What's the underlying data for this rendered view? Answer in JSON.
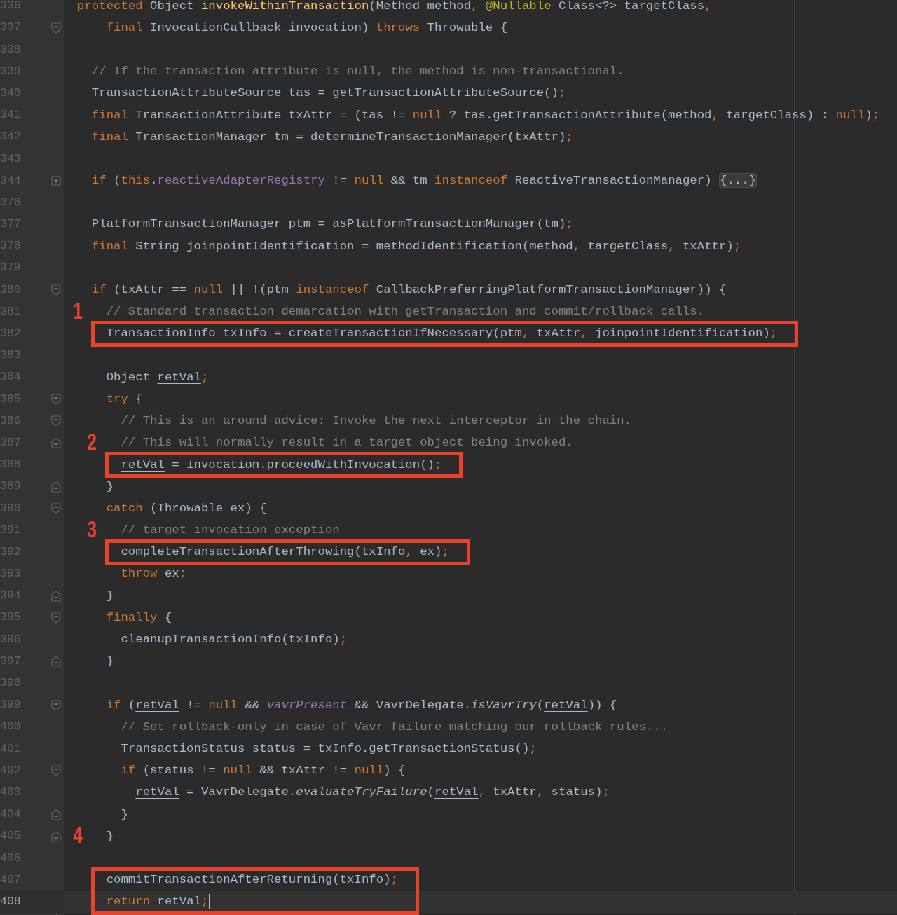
{
  "editor": {
    "lines": [
      {
        "number": "336",
        "current": false,
        "tokens": [
          {
            "kind": "keyword",
            "text": "protected"
          },
          {
            "kind": "plain",
            "text": " Object "
          },
          {
            "kind": "declaration",
            "text": "invokeWithinTransaction"
          },
          {
            "kind": "plain",
            "text": "(Method method"
          },
          {
            "kind": "keyword",
            "text": ","
          },
          {
            "kind": "annotation",
            "text": " @Nullable"
          },
          {
            "kind": "plain",
            "text": " Class<?> targetClass"
          },
          {
            "kind": "keyword",
            "text": ","
          }
        ]
      },
      {
        "number": "337",
        "current": false,
        "fold_start": true,
        "tokens": [
          {
            "kind": "keyword",
            "text": "    final"
          },
          {
            "kind": "plain",
            "text": " InvocationCallback invocation) "
          },
          {
            "kind": "keyword",
            "text": "throws"
          },
          {
            "kind": "plain",
            "text": " Throwable {"
          }
        ]
      },
      {
        "number": "338",
        "current": false
      },
      {
        "number": "339",
        "current": false,
        "tokens": [
          {
            "kind": "comment",
            "text": "  // If the transaction attribute is null, the method is non-transactional."
          }
        ]
      },
      {
        "number": "340",
        "current": false,
        "tokens": [
          {
            "kind": "plain",
            "text": "  TransactionAttributeSource tas = getTransactionAttributeSource()"
          },
          {
            "kind": "keyword",
            "text": ";"
          }
        ]
      },
      {
        "number": "341",
        "current": false,
        "tokens": [
          {
            "kind": "keyword",
            "text": "  final"
          },
          {
            "kind": "plain",
            "text": " TransactionAttribute txAttr = (tas != "
          },
          {
            "kind": "keyword",
            "text": "null"
          },
          {
            "kind": "plain",
            "text": " ? tas.getTransactionAttribute(method"
          },
          {
            "kind": "keyword",
            "text": ","
          },
          {
            "kind": "plain",
            "text": " targetClass) : "
          },
          {
            "kind": "keyword",
            "text": "null"
          },
          {
            "kind": "plain",
            "text": ")"
          },
          {
            "kind": "keyword",
            "text": ";"
          }
        ]
      },
      {
        "number": "342",
        "current": false,
        "tokens": [
          {
            "kind": "keyword",
            "text": "  final"
          },
          {
            "kind": "plain",
            "text": " TransactionManager tm = determineTransactionManager(txAttr)"
          },
          {
            "kind": "keyword",
            "text": ";"
          }
        ]
      },
      {
        "number": "343",
        "current": false
      },
      {
        "number": "344",
        "current": false,
        "collapsed": true,
        "tokens": [
          {
            "kind": "keyword",
            "text": "  if"
          },
          {
            "kind": "plain",
            "text": " ("
          },
          {
            "kind": "keyword",
            "text": "this"
          },
          {
            "kind": "plain",
            "text": "."
          },
          {
            "kind": "field",
            "text": "reactiveAdapterRegistry"
          },
          {
            "kind": "plain",
            "text": " != "
          },
          {
            "kind": "keyword",
            "text": "null"
          },
          {
            "kind": "plain",
            "text": " && tm "
          },
          {
            "kind": "keyword",
            "text": "instanceof"
          },
          {
            "kind": "plain",
            "text": " ReactiveTransactionManager) "
          },
          {
            "kind": "folded",
            "text": "{...}"
          }
        ]
      },
      {
        "number": "376",
        "current": false
      },
      {
        "number": "377",
        "current": false,
        "tokens": [
          {
            "kind": "plain",
            "text": "  PlatformTransactionManager ptm = asPlatformTransactionManager(tm)"
          },
          {
            "kind": "keyword",
            "text": ";"
          }
        ]
      },
      {
        "number": "378",
        "current": false,
        "tokens": [
          {
            "kind": "keyword",
            "text": "  final"
          },
          {
            "kind": "plain",
            "text": " String joinpointIdentification = methodIdentification(method"
          },
          {
            "kind": "keyword",
            "text": ","
          },
          {
            "kind": "plain",
            "text": " targetClass"
          },
          {
            "kind": "keyword",
            "text": ","
          },
          {
            "kind": "plain",
            "text": " txAttr)"
          },
          {
            "kind": "keyword",
            "text": ";"
          }
        ]
      },
      {
        "number": "379",
        "current": false
      },
      {
        "number": "380",
        "current": false,
        "fold_start": true,
        "tokens": [
          {
            "kind": "keyword",
            "text": "  if"
          },
          {
            "kind": "plain",
            "text": " (txAttr == "
          },
          {
            "kind": "keyword",
            "text": "null"
          },
          {
            "kind": "plain",
            "text": " || !(ptm "
          },
          {
            "kind": "keyword",
            "text": "instanceof"
          },
          {
            "kind": "plain",
            "text": " CallbackPreferringPlatformTransactionManager)) {"
          }
        ]
      },
      {
        "number": "381",
        "current": false,
        "marker": "1",
        "tokens": [
          {
            "kind": "comment",
            "text": "    // Standard transaction demarcation with getTransaction and commit/rollback calls."
          }
        ]
      },
      {
        "number": "382",
        "current": false,
        "boxed": true,
        "tokens": [
          {
            "kind": "plain",
            "text": "    TransactionInfo txInfo = createTransactionIfNecessary(ptm"
          },
          {
            "kind": "keyword",
            "text": ","
          },
          {
            "kind": "plain",
            "text": " txAttr"
          },
          {
            "kind": "keyword",
            "text": ","
          },
          {
            "kind": "plain",
            "text": " joinpointIdentification)"
          },
          {
            "kind": "keyword",
            "text": ";"
          }
        ]
      },
      {
        "number": "383",
        "current": false
      },
      {
        "number": "384",
        "current": false,
        "tokens": [
          {
            "kind": "plain",
            "text": "    Object "
          },
          {
            "kind": "variable",
            "text": "retVal"
          },
          {
            "kind": "keyword",
            "text": ";"
          }
        ]
      },
      {
        "number": "385",
        "current": false,
        "fold_start": true,
        "tokens": [
          {
            "kind": "keyword",
            "text": "    try"
          },
          {
            "kind": "plain",
            "text": " {"
          }
        ]
      },
      {
        "number": "386",
        "current": false,
        "fold_start": true,
        "tokens": [
          {
            "kind": "comment",
            "text": "      // This is an around advice: Invoke the next interceptor in the chain."
          }
        ]
      },
      {
        "number": "387",
        "current": false,
        "fold_end": true,
        "marker": "2",
        "tokens": [
          {
            "kind": "comment",
            "text": "      // This will normally result in a target object being invoked."
          }
        ]
      },
      {
        "number": "388",
        "current": false,
        "boxed": true,
        "tokens": [
          {
            "kind": "variable",
            "text": "      retVal"
          },
          {
            "kind": "plain",
            "text": " = invocation.proceedWithInvocation()"
          },
          {
            "kind": "keyword",
            "text": ";"
          }
        ]
      },
      {
        "number": "389",
        "current": false,
        "fold_end": true,
        "tokens": [
          {
            "kind": "plain",
            "text": "    }"
          }
        ]
      },
      {
        "number": "390",
        "current": false,
        "fold_start": true,
        "tokens": [
          {
            "kind": "keyword",
            "text": "    catch"
          },
          {
            "kind": "plain",
            "text": " (Throwable ex) {"
          }
        ]
      },
      {
        "number": "391",
        "current": false,
        "marker": "3",
        "tokens": [
          {
            "kind": "comment",
            "text": "      // target invocation exception"
          }
        ]
      },
      {
        "number": "392",
        "current": false,
        "boxed": true,
        "tokens": [
          {
            "kind": "plain",
            "text": "      completeTransactionAfterThrowing(txInfo"
          },
          {
            "kind": "keyword",
            "text": ","
          },
          {
            "kind": "plain",
            "text": " ex)"
          },
          {
            "kind": "keyword",
            "text": ";"
          }
        ]
      },
      {
        "number": "393",
        "current": false,
        "tokens": [
          {
            "kind": "keyword",
            "text": "      throw"
          },
          {
            "kind": "plain",
            "text": " ex"
          },
          {
            "kind": "keyword",
            "text": ";"
          }
        ]
      },
      {
        "number": "394",
        "current": false,
        "fold_end": true,
        "tokens": [
          {
            "kind": "plain",
            "text": "    }"
          }
        ]
      },
      {
        "number": "395",
        "current": false,
        "fold_start": true,
        "tokens": [
          {
            "kind": "keyword",
            "text": "    finally"
          },
          {
            "kind": "plain",
            "text": " {"
          }
        ]
      },
      {
        "number": "396",
        "current": false,
        "tokens": [
          {
            "kind": "plain",
            "text": "      cleanupTransactionInfo(txInfo)"
          },
          {
            "kind": "keyword",
            "text": ";"
          }
        ]
      },
      {
        "number": "397",
        "current": false,
        "fold_end": true,
        "tokens": [
          {
            "kind": "plain",
            "text": "    }"
          }
        ]
      },
      {
        "number": "398",
        "current": false
      },
      {
        "number": "399",
        "current": false,
        "fold_start": true,
        "tokens": [
          {
            "kind": "keyword",
            "text": "    if"
          },
          {
            "kind": "plain",
            "text": " ("
          },
          {
            "kind": "variable",
            "text": "retVal"
          },
          {
            "kind": "plain",
            "text": " != "
          },
          {
            "kind": "keyword",
            "text": "null"
          },
          {
            "kind": "plain",
            "text": " && "
          },
          {
            "kind": "static",
            "text": "vavrPresent"
          },
          {
            "kind": "plain",
            "text": " && VavrDelegate."
          },
          {
            "kind": "italic",
            "text": "isVavrTry"
          },
          {
            "kind": "plain",
            "text": "("
          },
          {
            "kind": "variable",
            "text": "retVal"
          },
          {
            "kind": "plain",
            "text": ")) {"
          }
        ]
      },
      {
        "number": "400",
        "current": false,
        "tokens": [
          {
            "kind": "comment",
            "text": "      // Set rollback-only in case of Vavr failure matching our rollback rules..."
          }
        ]
      },
      {
        "number": "401",
        "current": false,
        "tokens": [
          {
            "kind": "plain",
            "text": "      TransactionStatus status = txInfo.getTransactionStatus()"
          },
          {
            "kind": "keyword",
            "text": ";"
          }
        ]
      },
      {
        "number": "402",
        "current": false,
        "fold_start": true,
        "tokens": [
          {
            "kind": "keyword",
            "text": "      if"
          },
          {
            "kind": "plain",
            "text": " (status != "
          },
          {
            "kind": "keyword",
            "text": "null"
          },
          {
            "kind": "plain",
            "text": " && txAttr != "
          },
          {
            "kind": "keyword",
            "text": "null"
          },
          {
            "kind": "plain",
            "text": ") {"
          }
        ]
      },
      {
        "number": "403",
        "current": false,
        "tokens": [
          {
            "kind": "variable",
            "text": "        retVal"
          },
          {
            "kind": "plain",
            "text": " = VavrDelegate."
          },
          {
            "kind": "italic",
            "text": "evaluateTryFailure"
          },
          {
            "kind": "plain",
            "text": "("
          },
          {
            "kind": "variable",
            "text": "retVal"
          },
          {
            "kind": "keyword",
            "text": ","
          },
          {
            "kind": "plain",
            "text": " txAttr"
          },
          {
            "kind": "keyword",
            "text": ","
          },
          {
            "kind": "plain",
            "text": " status)"
          },
          {
            "kind": "keyword",
            "text": ";"
          }
        ]
      },
      {
        "number": "404",
        "current": false,
        "fold_end": true,
        "tokens": [
          {
            "kind": "plain",
            "text": "      }"
          }
        ]
      },
      {
        "number": "405",
        "current": false,
        "fold_end": true,
        "marker": "4",
        "tokens": [
          {
            "kind": "plain",
            "text": "    }"
          }
        ]
      },
      {
        "number": "406",
        "current": false
      },
      {
        "number": "407",
        "current": false,
        "boxed": true,
        "tokens": [
          {
            "kind": "plain",
            "text": "    commitTransactionAfterReturning(txInfo)"
          },
          {
            "kind": "keyword",
            "text": ";"
          }
        ]
      },
      {
        "number": "408",
        "current": true,
        "boxed": true,
        "caret": true,
        "tokens": [
          {
            "kind": "keyword",
            "text": "    return"
          },
          {
            "kind": "plain",
            "text": " retVal"
          },
          {
            "kind": "keyword",
            "text": ";"
          }
        ]
      }
    ]
  }
}
